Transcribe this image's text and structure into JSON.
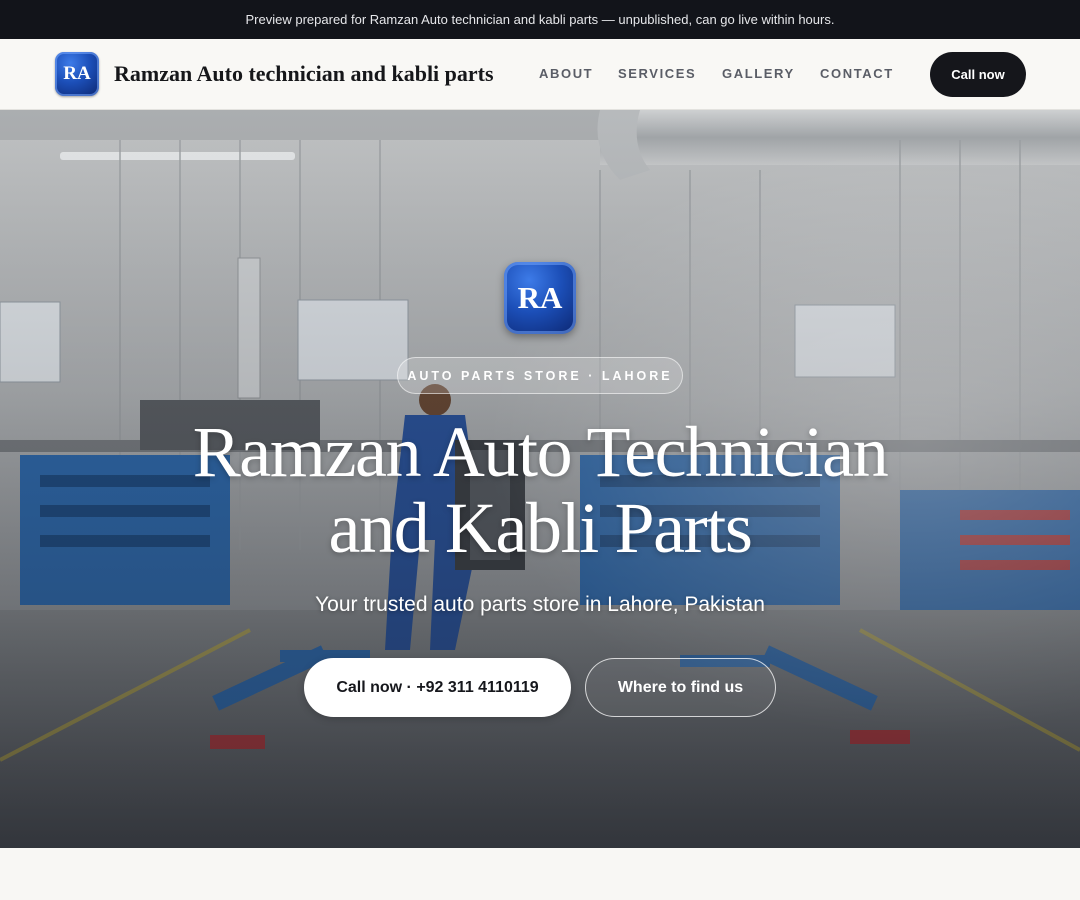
{
  "preview_banner": {
    "text": "Preview prepared for Ramzan Auto technician and kabli parts — unpublished, can go live within hours."
  },
  "header": {
    "logo_initials": "RA",
    "brand_name": "Ramzan Auto technician and kabli parts",
    "nav": {
      "about": "ABOUT",
      "services": "SERVICES",
      "gallery": "GALLERY",
      "contact": "CONTACT"
    },
    "call_label": "Call now"
  },
  "hero": {
    "logo_initials": "RA",
    "eyebrow": "AUTO PARTS STORE · LAHORE",
    "title_line1": "Ramzan Auto Technician",
    "title_line2": "and Kabli Parts",
    "subtitle": "Your trusted auto parts store in Lahore, Pakistan",
    "call_label": "Call now · +92 311 4110119",
    "find_label": "Where to find us",
    "background_icon": "auto-workshop-photo"
  },
  "colors": {
    "brand_blue": "#1c4fb8",
    "dark": "#15161b",
    "banner_bg": "#12141a",
    "page_bg": "#f8f7f4"
  }
}
